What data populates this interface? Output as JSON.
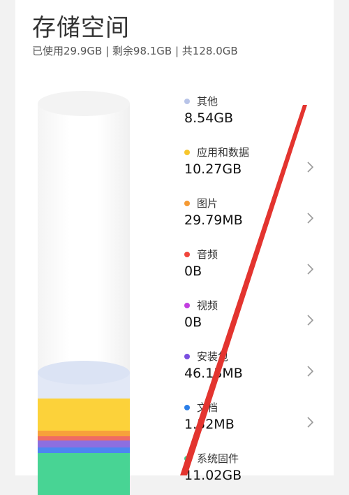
{
  "title": "存储空间",
  "summary": "已使用29.9GB | 剩余98.1GB | 共128.0GB",
  "items": [
    {
      "label": "其他",
      "value": "8.54GB",
      "color": "#b8c4e8",
      "chevron": false
    },
    {
      "label": "应用和数据",
      "value": "10.27GB",
      "color": "#f7c62d",
      "chevron": true
    },
    {
      "label": "图片",
      "value": "29.79MB",
      "color": "#f59a34",
      "chevron": true
    },
    {
      "label": "音频",
      "value": "0B",
      "color": "#f0463c",
      "chevron": true
    },
    {
      "label": "视频",
      "value": "0B",
      "color": "#c23fe0",
      "chevron": true
    },
    {
      "label": "安装包",
      "value": "46.13MB",
      "color": "#7a4fe0",
      "chevron": true
    },
    {
      "label": "文档",
      "value": "1.52MB",
      "color": "#2b7fe8",
      "chevron": true
    },
    {
      "label": "系统固件",
      "value": "11.02GB",
      "color": "#3ccf86",
      "chevron": false
    }
  ],
  "icons": {
    "chevron": "chevron-right-icon"
  },
  "annotation_color": "#e3342f"
}
